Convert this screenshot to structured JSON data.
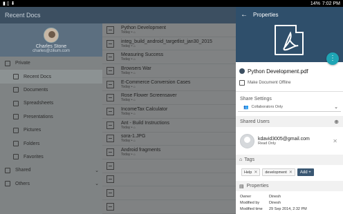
{
  "status": {
    "icons": "▮ ▯ ⬇",
    "battery": "14%",
    "time": "7:02 PM"
  },
  "app": {
    "title": "Recent Docs"
  },
  "drawer": {
    "profile": {
      "name": "Charles Stone",
      "email": "charles@zilium.com"
    },
    "items": [
      {
        "label": "Private",
        "icon": "home-icon",
        "level": "top"
      },
      {
        "label": "Recent Docs",
        "icon": "recent-icon",
        "level": "sub",
        "selected": true
      },
      {
        "label": "Documents",
        "icon": "document-icon",
        "level": "sub"
      },
      {
        "label": "Spreadsheets",
        "icon": "spreadsheet-icon",
        "level": "sub"
      },
      {
        "label": "Presentations",
        "icon": "presentation-icon",
        "level": "sub"
      },
      {
        "label": "Pictures",
        "icon": "picture-icon",
        "level": "sub"
      },
      {
        "label": "Folders",
        "icon": "folder-icon",
        "level": "sub"
      },
      {
        "label": "Favorites",
        "icon": "star-icon",
        "level": "sub"
      },
      {
        "label": "Shared",
        "icon": "share-icon",
        "level": "top",
        "chevron": "⌄"
      },
      {
        "label": "Others",
        "icon": "grid-icon",
        "level": "top",
        "chevron": "⌄"
      }
    ]
  },
  "files": [
    {
      "name": "Python Development",
      "meta": "Today  •  ⌂"
    },
    {
      "name": "integ_build_android_targetlist_jan30_2015",
      "meta": "Today  •  ⌂"
    },
    {
      "name": "Measuring Success",
      "meta": "Today  •  ⌂"
    },
    {
      "name": "Browsers War",
      "meta": "Today  •  ⌂"
    },
    {
      "name": "E-Commerce Conversion Cases",
      "meta": "Today  •  ⌂"
    },
    {
      "name": "Rose Flower Screensaver",
      "meta": "Today  •  ⌂"
    },
    {
      "name": "IncomeTax Calculator",
      "meta": "Today  •  ⌂"
    },
    {
      "name": "Ant - Build Instructions",
      "meta": "Today  •  ⌂"
    },
    {
      "name": "sora-1.JPG",
      "meta": "Today  •  ⌂"
    },
    {
      "name": "Android fragments",
      "meta": "Today  •  ⌂"
    },
    {
      "name": "",
      "meta": ""
    },
    {
      "name": "",
      "meta": ""
    },
    {
      "name": "",
      "meta": ""
    },
    {
      "name": "",
      "meta": ""
    }
  ],
  "panel": {
    "title": "Properties",
    "back_icon": "←",
    "fab_icon": "⋮",
    "file_name": "Python Development.pdf",
    "offline_label": "Make Document Offline",
    "share_settings_label": "Share Settings",
    "share_value": "Collaborators Only",
    "shared_users_label": "Shared Users",
    "user_email": "kdavid3005@gmail.com",
    "user_role": "Read Only",
    "tags_label": "Tags",
    "tags": [
      "Help",
      "development"
    ],
    "add_label": "Add +",
    "properties_label": "Properties",
    "owner_key": "Owner",
    "owner_value": "Dinesh",
    "modified_by_key": "Modified by",
    "modified_by_value": "Dinesh",
    "modified_time_key": "Modified time",
    "modified_time_value": "29 Sep 2014, 2:32 PM"
  },
  "colors": {
    "accent": "#1fa5b5",
    "header": "#2f4f6b",
    "appbar": "#3c4f61"
  }
}
